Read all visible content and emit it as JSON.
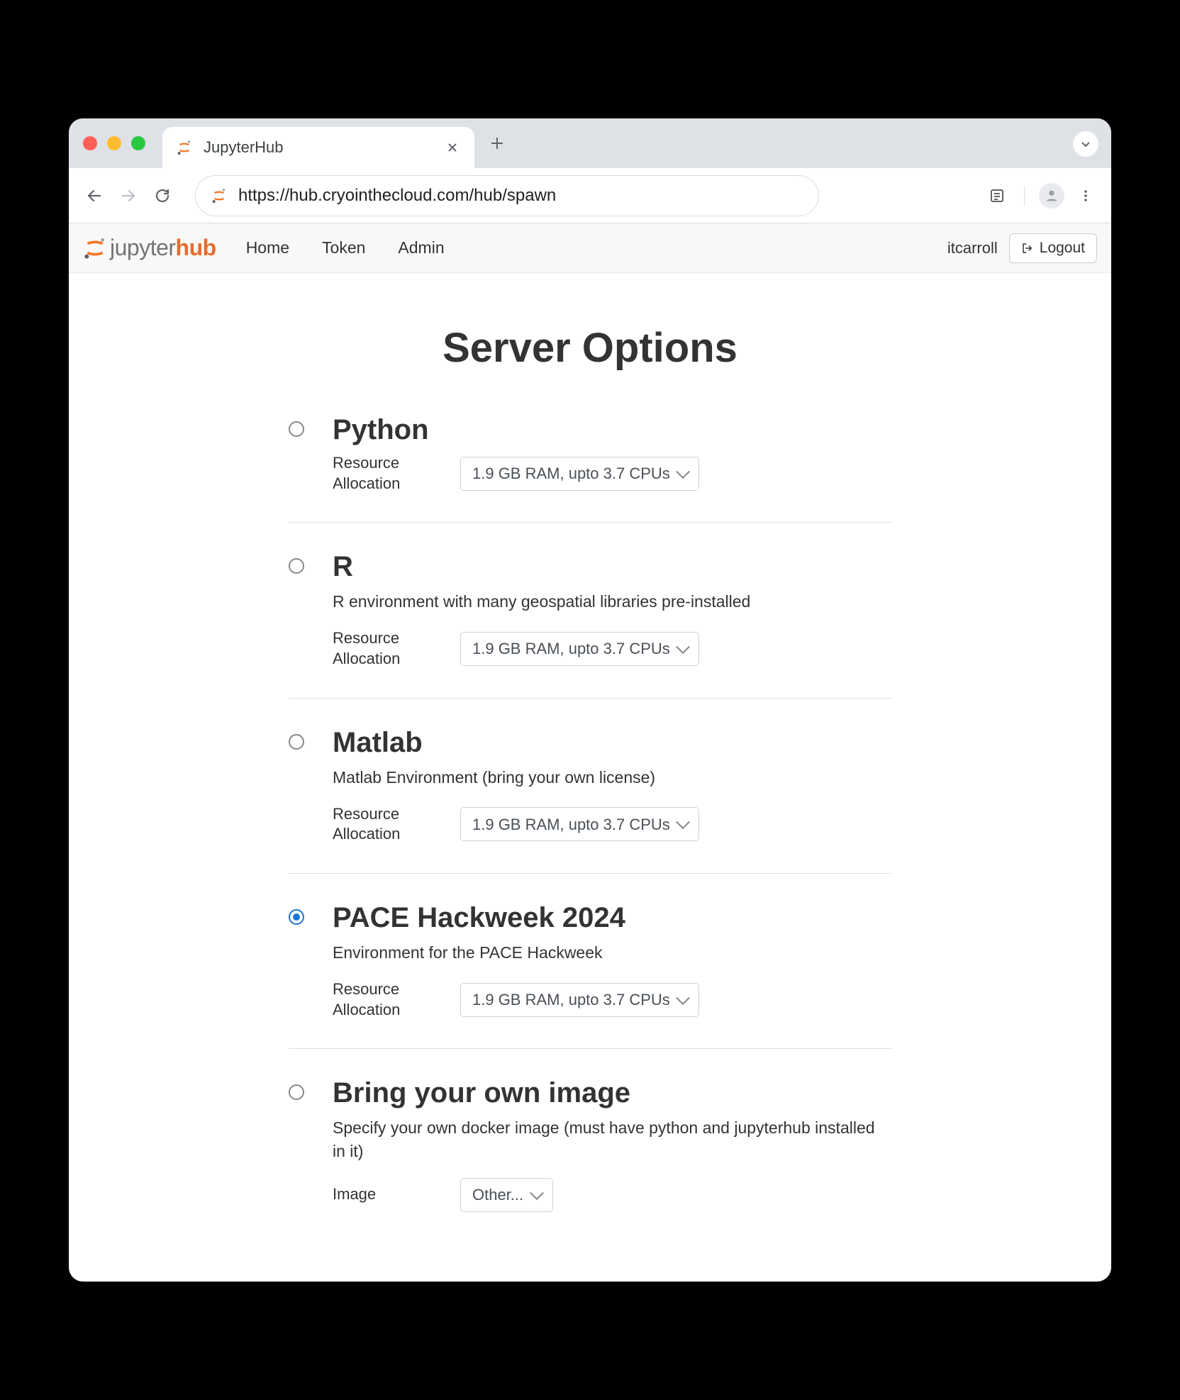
{
  "browser": {
    "tab_title": "JupyterHub",
    "url": "https://hub.cryointhecloud.com/hub/spawn"
  },
  "navbar": {
    "brand_jupyter": "jupyter",
    "brand_hub": "hub",
    "links": [
      "Home",
      "Token",
      "Admin"
    ],
    "username": "itcarroll",
    "logout": "Logout"
  },
  "page": {
    "title": "Server Options",
    "options": [
      {
        "title": "Python",
        "description": "",
        "field_label": "Resource Allocation",
        "field_type": "select",
        "field_value": "1.9 GB RAM, upto 3.7 CPUs",
        "checked": false
      },
      {
        "title": "R",
        "description": "R environment with many geospatial libraries pre-installed",
        "field_label": "Resource Allocation",
        "field_type": "select",
        "field_value": "1.9 GB RAM, upto 3.7 CPUs",
        "checked": false
      },
      {
        "title": "Matlab",
        "description": "Matlab Environment (bring your own license)",
        "field_label": "Resource Allocation",
        "field_type": "select",
        "field_value": "1.9 GB RAM, upto 3.7 CPUs",
        "checked": false
      },
      {
        "title": "PACE Hackweek 2024",
        "description": "Environment for the PACE Hackweek",
        "field_label": "Resource Allocation",
        "field_type": "select",
        "field_value": "1.9 GB RAM, upto 3.7 CPUs",
        "checked": true
      },
      {
        "title": "Bring your own image",
        "description": "Specify your own docker image (must have python and jupyterhub installed in it)",
        "field_label": "Image",
        "field_type": "select",
        "field_value": "Other...",
        "checked": false
      }
    ]
  }
}
